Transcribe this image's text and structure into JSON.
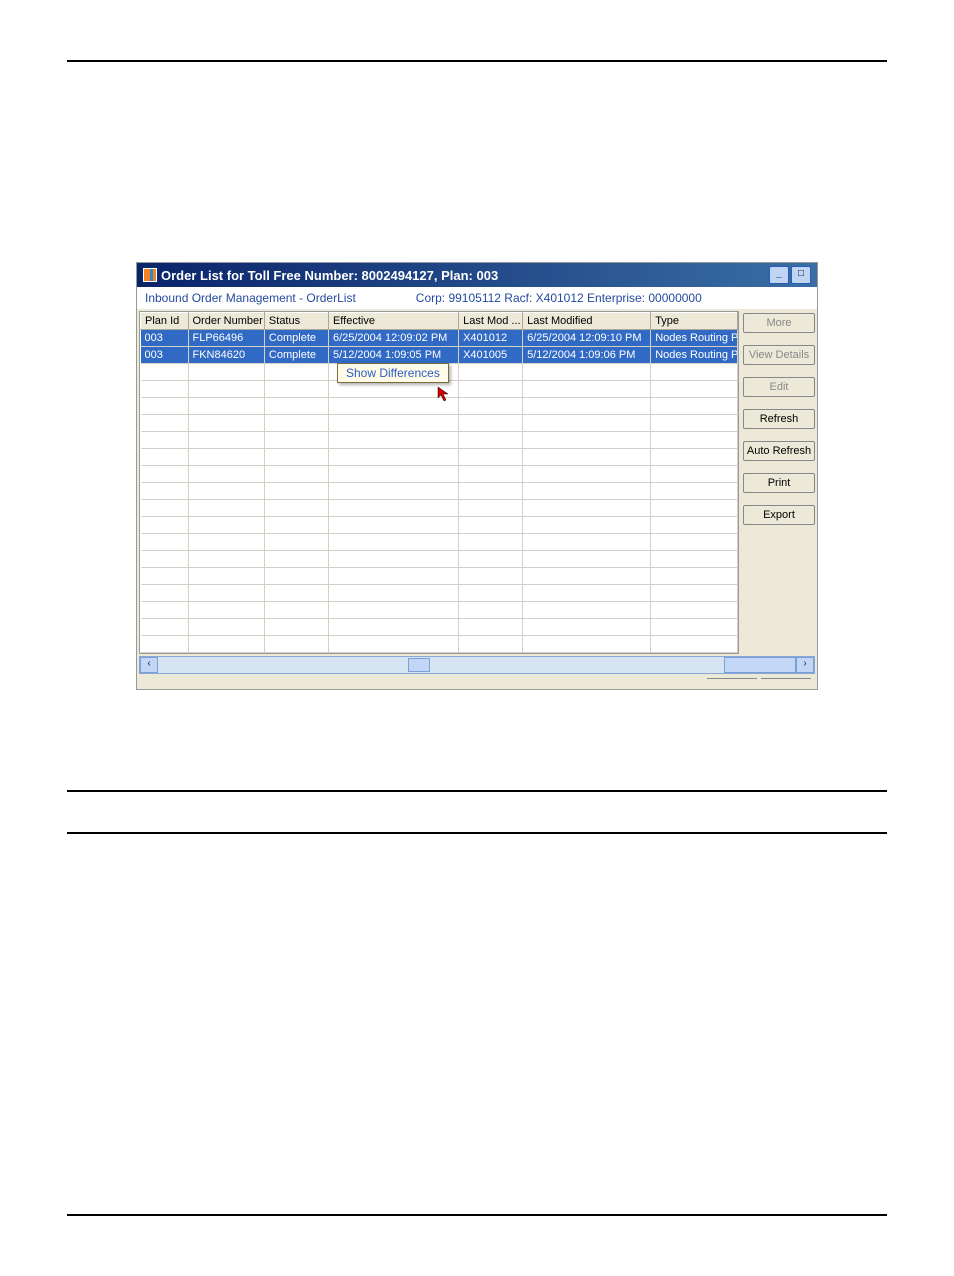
{
  "window": {
    "title": "Order List for Toll Free Number: 8002494127, Plan: 003"
  },
  "subbar": {
    "breadcrumb": "Inbound Order Management - OrderList",
    "info": "Corp: 99105112  Racf:  X401012   Enterprise: 00000000"
  },
  "headers": [
    "Plan Id",
    "Order Number",
    "Status",
    "Effective",
    "Last Mod ...",
    "Last Modified",
    "Type"
  ],
  "rows": [
    {
      "plan": "003",
      "order": "FLP66496",
      "status": "Complete",
      "effective": "6/25/2004 12:09:02 PM",
      "modby": "X401012",
      "moddate": "6/25/2004 12:09:10 PM",
      "type": "Nodes Routing Pl"
    },
    {
      "plan": "003",
      "order": "FKN84620",
      "status": "Complete",
      "effective": "5/12/2004 1:09:05 PM",
      "modby": "X401005",
      "moddate": "5/12/2004 1:09:06 PM",
      "type": "Nodes Routing Pl"
    }
  ],
  "context_menu": {
    "item1": "Show Differences"
  },
  "buttons": {
    "more": "More",
    "view_details": "View Details",
    "edit": "Edit",
    "refresh": "Refresh",
    "auto_refresh": "Auto Refresh",
    "print": "Print",
    "export": "Export"
  }
}
